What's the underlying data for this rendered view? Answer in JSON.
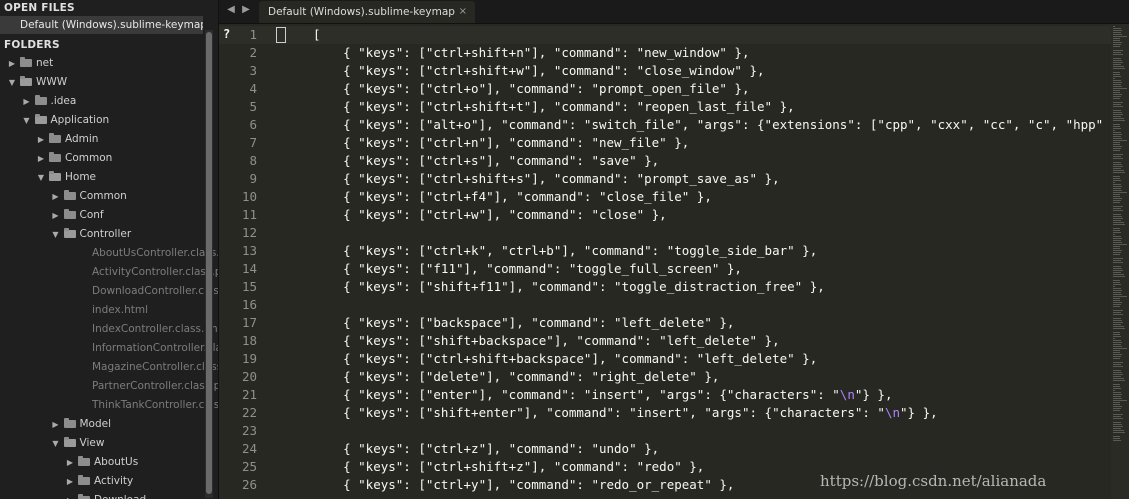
{
  "sidebar": {
    "open_files_title": "OPEN FILES",
    "open_file": "Default (Windows).sublime-keymap",
    "folders_title": "FOLDERS",
    "tree": [
      {
        "label": "net",
        "type": "folder",
        "depth": 0,
        "expanded": false
      },
      {
        "label": "WWW",
        "type": "folder",
        "depth": 0,
        "expanded": true
      },
      {
        "label": ".idea",
        "type": "folder",
        "depth": 1,
        "expanded": false
      },
      {
        "label": "Application",
        "type": "folder",
        "depth": 1,
        "expanded": true
      },
      {
        "label": "Admin",
        "type": "folder",
        "depth": 2,
        "expanded": false
      },
      {
        "label": "Common",
        "type": "folder",
        "depth": 2,
        "expanded": false
      },
      {
        "label": "Home",
        "type": "folder",
        "depth": 2,
        "expanded": true
      },
      {
        "label": "Common",
        "type": "folder",
        "depth": 3,
        "expanded": false
      },
      {
        "label": "Conf",
        "type": "folder",
        "depth": 3,
        "expanded": false
      },
      {
        "label": "Controller",
        "type": "folder",
        "depth": 3,
        "expanded": true
      },
      {
        "label": "AboutUsController.class.php",
        "type": "file",
        "depth": 4
      },
      {
        "label": "ActivityController.class.php",
        "type": "file",
        "depth": 4
      },
      {
        "label": "DownloadController.class.php",
        "type": "file",
        "depth": 4
      },
      {
        "label": "index.html",
        "type": "file",
        "depth": 4
      },
      {
        "label": "IndexController.class.php",
        "type": "file",
        "depth": 4
      },
      {
        "label": "InformationController.class.php",
        "type": "file",
        "depth": 4
      },
      {
        "label": "MagazineController.class.php",
        "type": "file",
        "depth": 4
      },
      {
        "label": "PartnerController.class.php",
        "type": "file",
        "depth": 4
      },
      {
        "label": "ThinkTankController.class.php",
        "type": "file",
        "depth": 4
      },
      {
        "label": "Model",
        "type": "folder",
        "depth": 3,
        "expanded": false
      },
      {
        "label": "View",
        "type": "folder",
        "depth": 3,
        "expanded": true
      },
      {
        "label": "AboutUs",
        "type": "folder",
        "depth": 4,
        "expanded": false
      },
      {
        "label": "Activity",
        "type": "folder",
        "depth": 4,
        "expanded": false
      },
      {
        "label": "Download",
        "type": "folder",
        "depth": 4,
        "expanded": false
      }
    ]
  },
  "tabbar": {
    "back_icon": "triangle-left-icon",
    "forward_icon": "triangle-right-icon",
    "tab_label": "Default (Windows).sublime-keymap",
    "close_glyph": "×"
  },
  "editor": {
    "marker": "?",
    "lines": [
      [
        {
          "t": "["
        }
      ],
      [
        {
          "t": "    { \"keys\": [\"ctrl+shift+n\"], \"command\": \"new_window\" },"
        }
      ],
      [
        {
          "t": "    { \"keys\": [\"ctrl+shift+w\"], \"command\": \"close_window\" },"
        }
      ],
      [
        {
          "t": "    { \"keys\": [\"ctrl+o\"], \"command\": \"prompt_open_file\" },"
        }
      ],
      [
        {
          "t": "    { \"keys\": [\"ctrl+shift+t\"], \"command\": \"reopen_last_file\" },"
        }
      ],
      [
        {
          "t": "    { \"keys\": [\"alt+o\"], \"command\": \"switch_file\", \"args\": {\"extensions\": [\"cpp\", \"cxx\", \"cc\", \"c\", \"hpp\""
        }
      ],
      [
        {
          "t": "    { \"keys\": [\"ctrl+n\"], \"command\": \"new_file\" },"
        }
      ],
      [
        {
          "t": "    { \"keys\": [\"ctrl+s\"], \"command\": \"save\" },"
        }
      ],
      [
        {
          "t": "    { \"keys\": [\"ctrl+shift+s\"], \"command\": \"prompt_save_as\" },"
        }
      ],
      [
        {
          "t": "    { \"keys\": [\"ctrl+f4\"], \"command\": \"close_file\" },"
        }
      ],
      [
        {
          "t": "    { \"keys\": [\"ctrl+w\"], \"command\": \"close\" },"
        }
      ],
      [
        {
          "t": ""
        }
      ],
      [
        {
          "t": "    { \"keys\": [\"ctrl+k\", \"ctrl+b\"], \"command\": \"toggle_side_bar\" },"
        }
      ],
      [
        {
          "t": "    { \"keys\": [\"f11\"], \"command\": \"toggle_full_screen\" },"
        }
      ],
      [
        {
          "t": "    { \"keys\": [\"shift+f11\"], \"command\": \"toggle_distraction_free\" },"
        }
      ],
      [
        {
          "t": ""
        }
      ],
      [
        {
          "t": "    { \"keys\": [\"backspace\"], \"command\": \"left_delete\" },"
        }
      ],
      [
        {
          "t": "    { \"keys\": [\"shift+backspace\"], \"command\": \"left_delete\" },"
        }
      ],
      [
        {
          "t": "    { \"keys\": [\"ctrl+shift+backspace\"], \"command\": \"left_delete\" },"
        }
      ],
      [
        {
          "t": "    { \"keys\": [\"delete\"], \"command\": \"right_delete\" },"
        }
      ],
      [
        {
          "t": "    { \"keys\": [\"enter\"], \"command\": \"insert\", \"args\": {\"characters\": \""
        },
        {
          "t": "\\n",
          "c": "esc"
        },
        {
          "t": "\"} },"
        }
      ],
      [
        {
          "t": "    { \"keys\": [\"shift+enter\"], \"command\": \"insert\", \"args\": {\"characters\": \""
        },
        {
          "t": "\\n",
          "c": "esc"
        },
        {
          "t": "\"} },"
        }
      ],
      [
        {
          "t": ""
        }
      ],
      [
        {
          "t": "    { \"keys\": [\"ctrl+z\"], \"command\": \"undo\" },"
        }
      ],
      [
        {
          "t": "    { \"keys\": [\"ctrl+shift+z\"], \"command\": \"redo\" },"
        }
      ],
      [
        {
          "t": "    { \"keys\": [\"ctrl+y\"], \"command\": \"redo_or_repeat\" },"
        }
      ]
    ]
  },
  "watermark": "https://blog.csdn.net/alianada",
  "colors": {
    "editor_bg": "#272822",
    "sidebar_bg": "#1f1f1f",
    "text": "#f8f8f2",
    "line_number": "#8f908a",
    "escape": "#ae81ff"
  }
}
